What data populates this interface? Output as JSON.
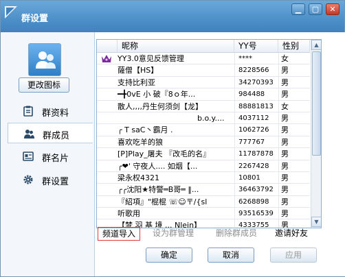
{
  "window": {
    "title": "群设置",
    "min": "▁",
    "max": "▢",
    "close": "✕"
  },
  "sidebar": {
    "change_icon_label": "更改图标",
    "items": [
      {
        "label": "群资料",
        "icon": "profile-icon"
      },
      {
        "label": "群成员",
        "icon": "members-icon"
      },
      {
        "label": "群名片",
        "icon": "card-icon"
      },
      {
        "label": "群设置",
        "icon": "gear-icon"
      }
    ],
    "active_index": 1
  },
  "table": {
    "headers": [
      "昵称",
      "YY号",
      "性别"
    ],
    "rows": [
      {
        "nick": "YY3.0意见反馈管理",
        "yy": "****",
        "sex": "女",
        "crown": true
      },
      {
        "nick": "薩僧【HS】",
        "yy": "8228566",
        "sex": "男"
      },
      {
        "nick": "支持比利亚",
        "yy": "34270393",
        "sex": "男"
      },
      {
        "nick": "━╋0vE 小  破『8ｏ年...",
        "yy": "984488",
        "sex": "男"
      },
      {
        "nick": "散人,,,,丹生何须剑【龙】",
        "yy": "88881813",
        "sex": "女"
      },
      {
        "nick": "b.o.y....",
        "yy": "4037112",
        "sex": "男"
      },
      {
        "nick": "╭    T saC丶霸月     .",
        "yy": "1062726",
        "sex": "男"
      },
      {
        "nick": "喜欢吃羊的狼",
        "yy": "777767",
        "sex": "男"
      },
      {
        "nick": "[P]Play_屠夫 『改毛的名』",
        "yy": "11787878",
        "sex": "男"
      },
      {
        "nick": "╭❤' 守夜人....    如烟【...",
        "yy": "2267428",
        "sex": "男"
      },
      {
        "nick": "梁永权4321",
        "yy": "10801",
        "sex": "男"
      },
      {
        "nick": "╭╭沈阳★特警═B哥═ ‖...",
        "yy": "36463792",
        "sex": "男"
      },
      {
        "nick": "『紹項』\"棍棍 ☏☺〒/{sl",
        "yy": "6268898",
        "sex": "男"
      },
      {
        "nick": "听歌用",
        "yy": "93516539",
        "sex": "男"
      },
      {
        "nick": "【梦 羽 基 境 ... Nlein】",
        "yy": "4333755",
        "sex": "男"
      }
    ]
  },
  "actions": {
    "import": "频道导入",
    "set_admin": "设为群管理",
    "remove": "删除群成员",
    "invite": "邀请好友"
  },
  "buttons": {
    "ok": "确定",
    "cancel": "取消",
    "apply": "应用"
  },
  "scroll": {
    "up": "▲",
    "down": "▼"
  }
}
